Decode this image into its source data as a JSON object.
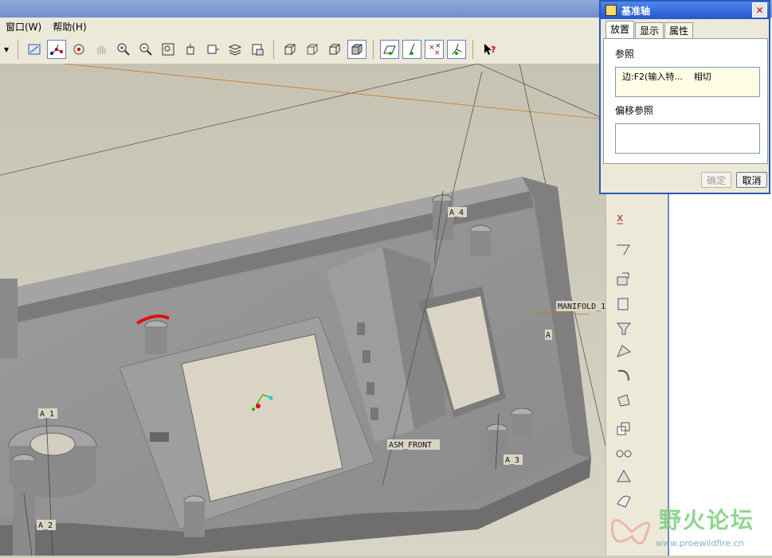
{
  "menubar": {
    "items": [
      "窗口(W)",
      "帮助(H)"
    ]
  },
  "toolbar": {
    "buttons": [
      "redraw-icon",
      "datum-axis-icon",
      "spin-center-icon",
      "pan-icon",
      "zoom-in-icon",
      "zoom-out-icon",
      "fit-icon",
      "orient-icon",
      "view-manager-icon",
      "layers-icon",
      "named-views-icon",
      "wireframe-icon",
      "hidden-line-icon",
      "no-hidden-icon",
      "shaded-icon",
      "datum-planes-icon",
      "datum-axes-icon",
      "datum-points-icon",
      "coord-sys-icon",
      "help-icon"
    ]
  },
  "model": {
    "labels": {
      "a4": "A_4",
      "a1": "A_1",
      "a2": "A_2",
      "a3": "A_3",
      "asm_front": "ASM_FRONT",
      "manifold": "MANIFOLD_1",
      "a_left": "A"
    }
  },
  "dialog": {
    "title": "基准轴",
    "tabs": [
      "放置",
      "显示",
      "属性"
    ],
    "ref_label": "参照",
    "ref_value": "边:F2(输入特...    相切",
    "offset_label": "偏移参照",
    "offset_value": "",
    "ok_label": "确定",
    "cancel_label": "取消"
  },
  "watermark": {
    "title": "野火论坛",
    "url": "www.proewildfire.cn"
  }
}
